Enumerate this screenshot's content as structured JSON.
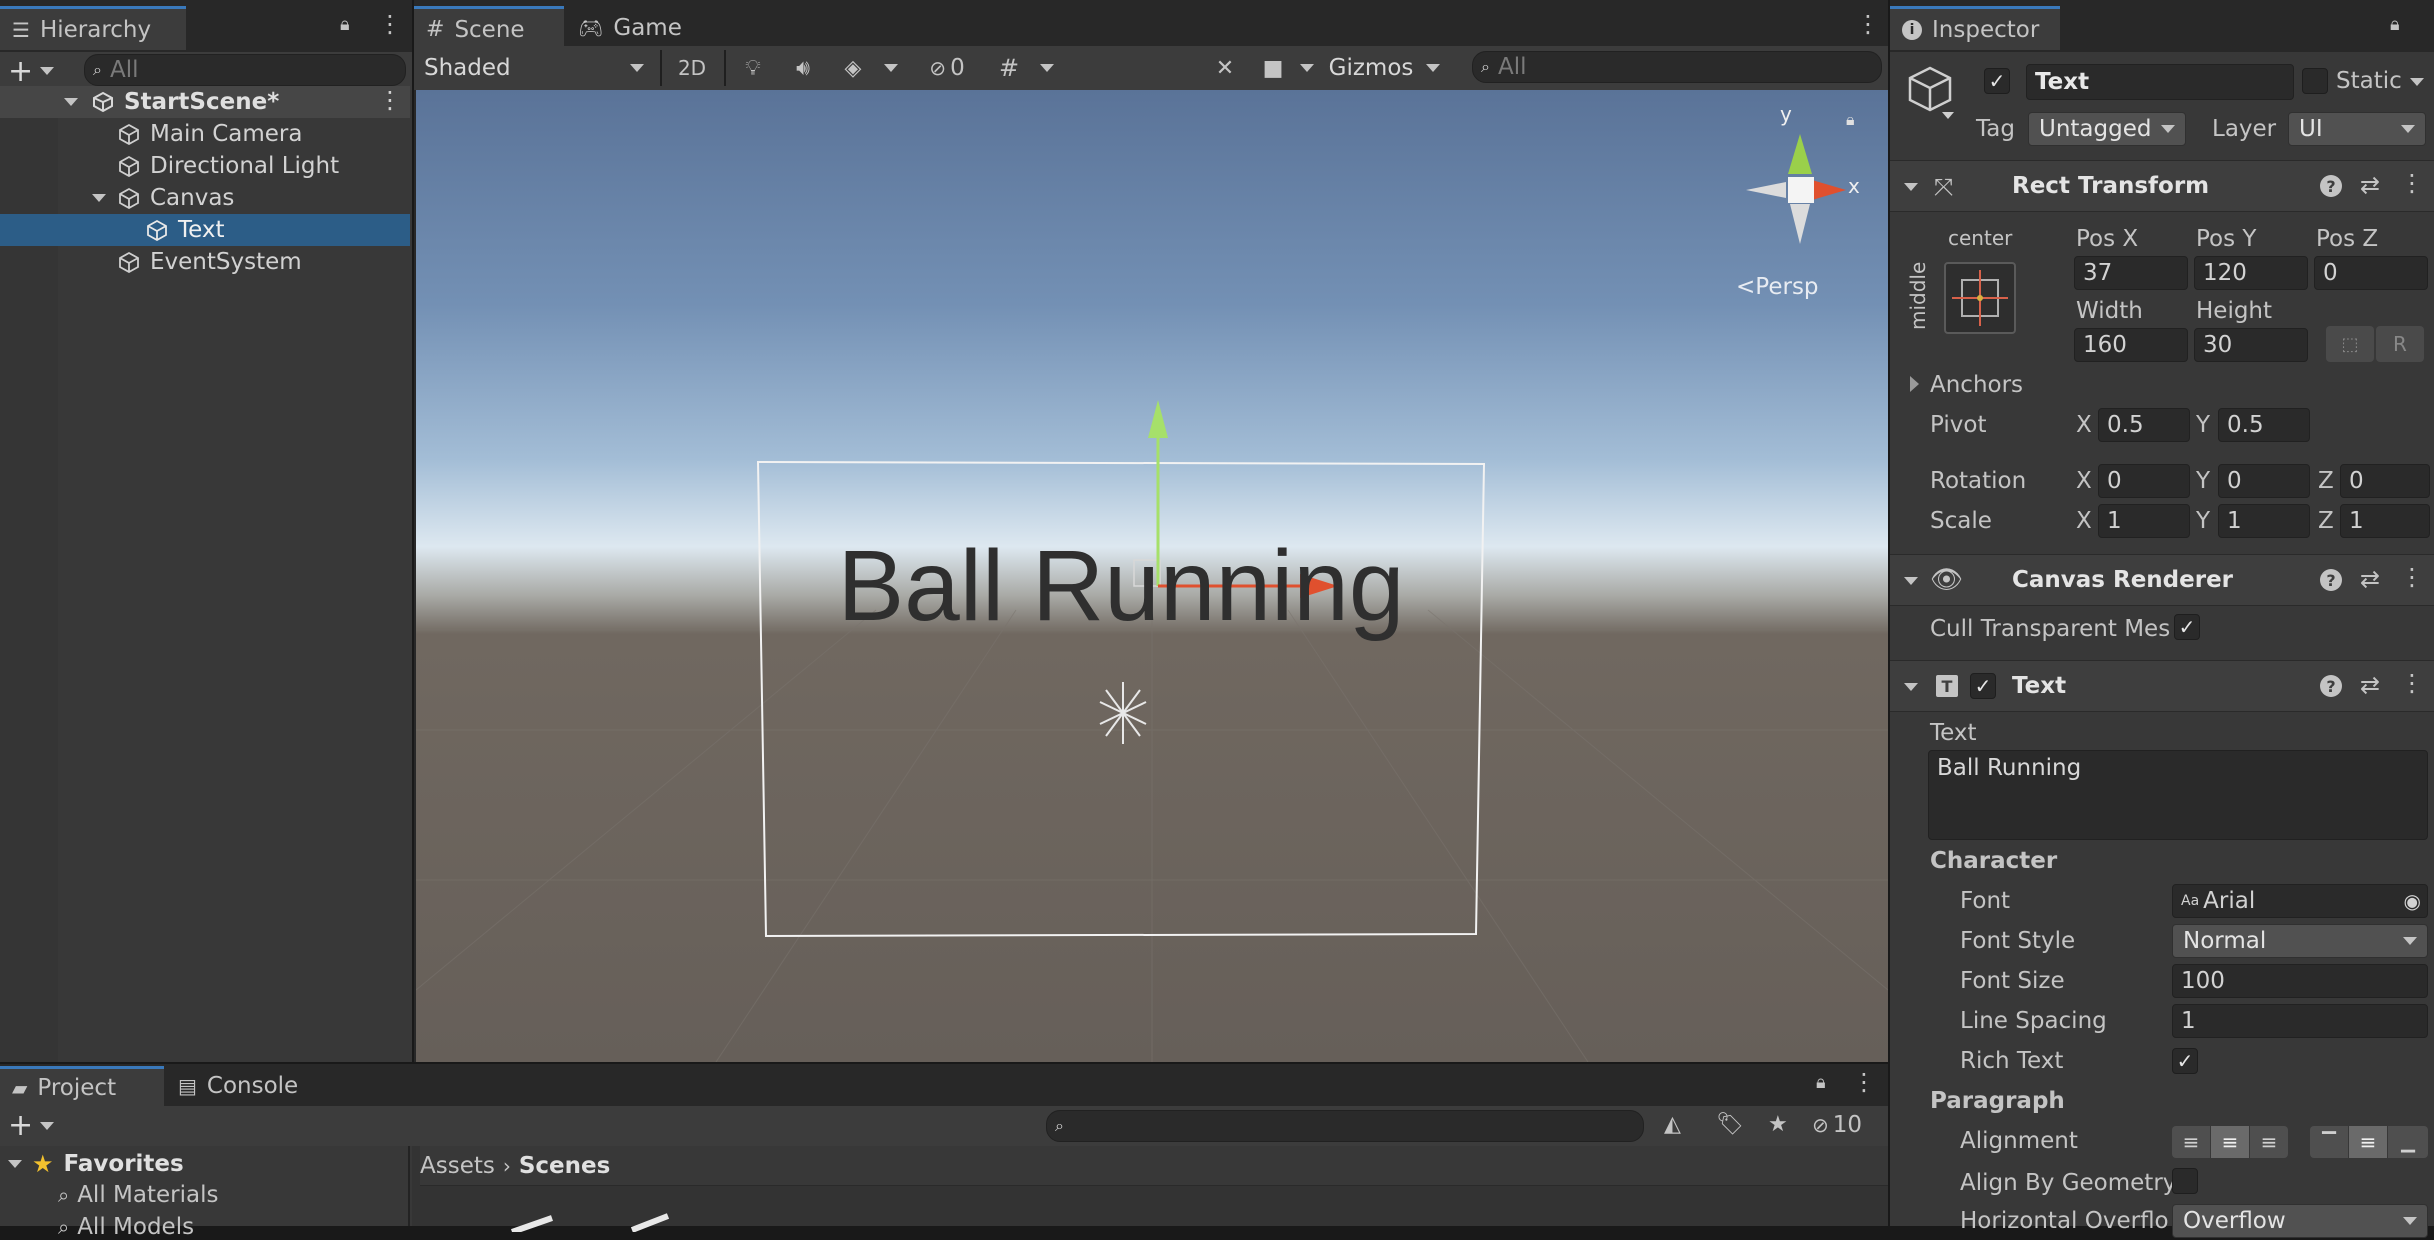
{
  "hierarchy": {
    "tab": "Hierarchy",
    "search_placeholder": "All",
    "scene": "StartScene*",
    "items": [
      {
        "label": "Main Camera"
      },
      {
        "label": "Directional Light"
      },
      {
        "label": "Canvas"
      },
      {
        "label": "Text"
      },
      {
        "label": "EventSystem"
      }
    ]
  },
  "scene_view": {
    "tabs": [
      "Scene",
      "Game"
    ],
    "draw_mode": "Shaded",
    "mode_2d": "2D",
    "hidden_count": "0",
    "gizmos": "Gizmos",
    "search_placeholder": "All",
    "gizmo_y": "y",
    "gizmo_x": "x",
    "persp": "Persp",
    "text_content": "Ball Running"
  },
  "inspector": {
    "tab": "Inspector",
    "object_name": "Text",
    "static_label": "Static",
    "tag_label": "Tag",
    "tag_value": "Untagged",
    "layer_label": "Layer",
    "layer_value": "UI",
    "rect_transform": {
      "title": "Rect Transform",
      "anchor_h": "center",
      "anchor_v": "middle",
      "pos_x_label": "Pos X",
      "pos_y_label": "Pos Y",
      "pos_z_label": "Pos Z",
      "pos_x": "37",
      "pos_y": "120",
      "pos_z": "0",
      "width_label": "Width",
      "height_label": "Height",
      "width": "160",
      "height": "30",
      "r_button": "R",
      "anchors_label": "Anchors",
      "pivot_label": "Pivot",
      "pivot_x": "0.5",
      "pivot_y": "0.5",
      "rotation_label": "Rotation",
      "rot_x": "0",
      "rot_y": "0",
      "rot_z": "0",
      "scale_label": "Scale",
      "scale_x": "1",
      "scale_y": "1",
      "scale_z": "1",
      "x": "X",
      "y": "Y",
      "z": "Z"
    },
    "canvas_renderer": {
      "title": "Canvas Renderer",
      "cull_label": "Cull Transparent Mes"
    },
    "text_component": {
      "title": "Text",
      "text_label": "Text",
      "text_value": "Ball Running",
      "character_label": "Character",
      "font_label": "Font",
      "font_value": "Arial",
      "font_prefix": "Aa",
      "font_style_label": "Font Style",
      "font_style_value": "Normal",
      "font_size_label": "Font Size",
      "font_size_value": "100",
      "line_spacing_label": "Line Spacing",
      "line_spacing_value": "1",
      "rich_text_label": "Rich Text",
      "paragraph_label": "Paragraph",
      "alignment_label": "Alignment",
      "align_geometry_label": "Align By Geometry",
      "h_overflow_label": "Horizontal Overflo",
      "h_overflow_value": "Overflow"
    }
  },
  "project": {
    "tabs": [
      "Project",
      "Console"
    ],
    "hidden_count": "10",
    "favorites_label": "Favorites",
    "favorites": [
      "All Materials",
      "All Models"
    ],
    "breadcrumb": [
      "Assets",
      "Scenes"
    ]
  },
  "colors": {
    "accent": "#3a79bb",
    "selection": "#2c5d87",
    "panel": "#383838",
    "text": "#c4c4c4"
  }
}
